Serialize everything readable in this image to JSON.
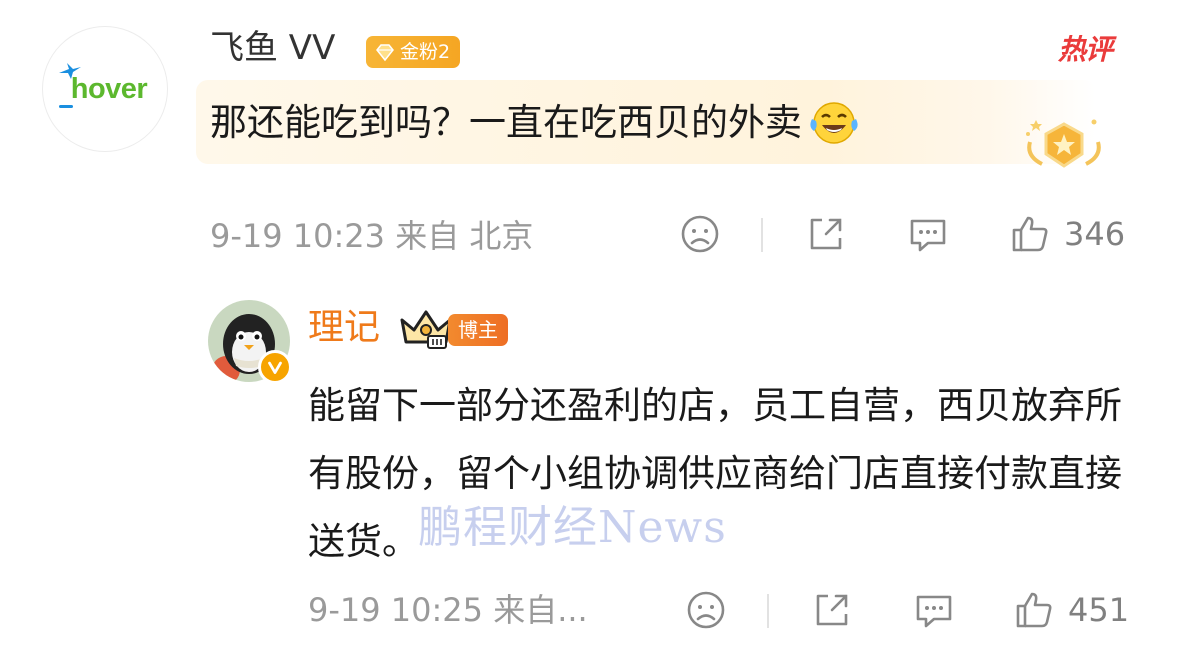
{
  "comment": {
    "avatar_logo": "hover",
    "username": "飞鱼 VV",
    "fan_badge": "金粉2",
    "hot_label": "热评",
    "text": "那还能吃到吗？一直在吃西贝的外卖",
    "emoji": "laughing-tears-emoji",
    "time": "9-19 10:23",
    "source": "来自 北京",
    "like_count": "346",
    "icons": {
      "dislike": "frown-face-icon",
      "share": "share-icon",
      "comment": "comment-bubble-icon",
      "like": "thumbs-up-icon"
    }
  },
  "reply": {
    "username": "理记",
    "blogger_badge": "博主",
    "text": "能留下一部分还盈利的店，员工自营，西贝放弃所有股份，留个小组协调供应商给门店直接付款直接送货。",
    "time": "9-19 10:25",
    "source": "来自...",
    "like_count": "451"
  },
  "watermark": "鹏程财经News",
  "colors": {
    "reply_username": "#ef7a1a",
    "hot_label": "#ea3b3b",
    "fan_badge": "#f5a623",
    "meta_gray": "#9a9a9a"
  }
}
